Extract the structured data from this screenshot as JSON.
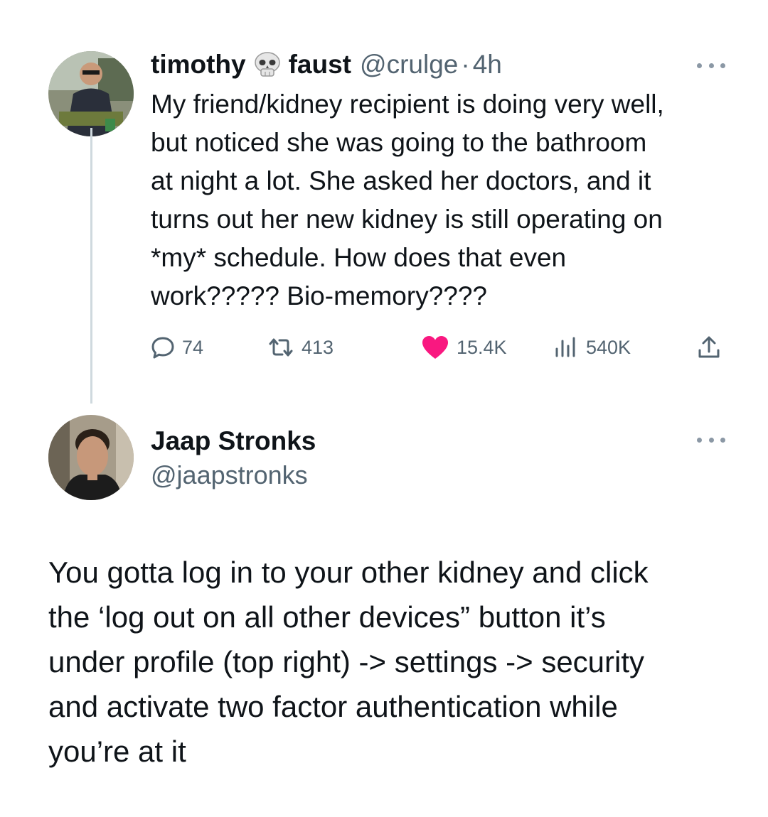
{
  "tweet": {
    "name_part1": "timothy",
    "name_part2": "faust",
    "handle": "@crulge",
    "separator": "·",
    "time": "4h",
    "lines": [
      "My friend/kidney recipient is doing very well,",
      "but noticed she was going to the bathroom",
      "at night a lot. She asked her doctors, and it",
      "turns out her new kidney is still operating on",
      "*my* schedule. How does that even",
      "work????? Bio-memory????"
    ],
    "actions": {
      "replies": "74",
      "retweets": "413",
      "likes": "15.4K",
      "views": "540K"
    },
    "icons": [
      "skull-emoji",
      "more-icon",
      "reply-icon",
      "retweet-icon",
      "heart-icon",
      "views-icon",
      "share-icon"
    ],
    "colors": {
      "like": "#f91880",
      "muted": "#536471",
      "thread_line": "#cfd9de"
    }
  },
  "reply": {
    "name": "Jaap Stronks",
    "handle": "@jaapstronks",
    "lines": [
      "You gotta log in to your other kidney and click",
      "the ‘log out on all other devices” button it’s",
      "under profile (top right) -> settings -> security",
      "and activate two factor authentication while",
      "you’re at it"
    ]
  }
}
